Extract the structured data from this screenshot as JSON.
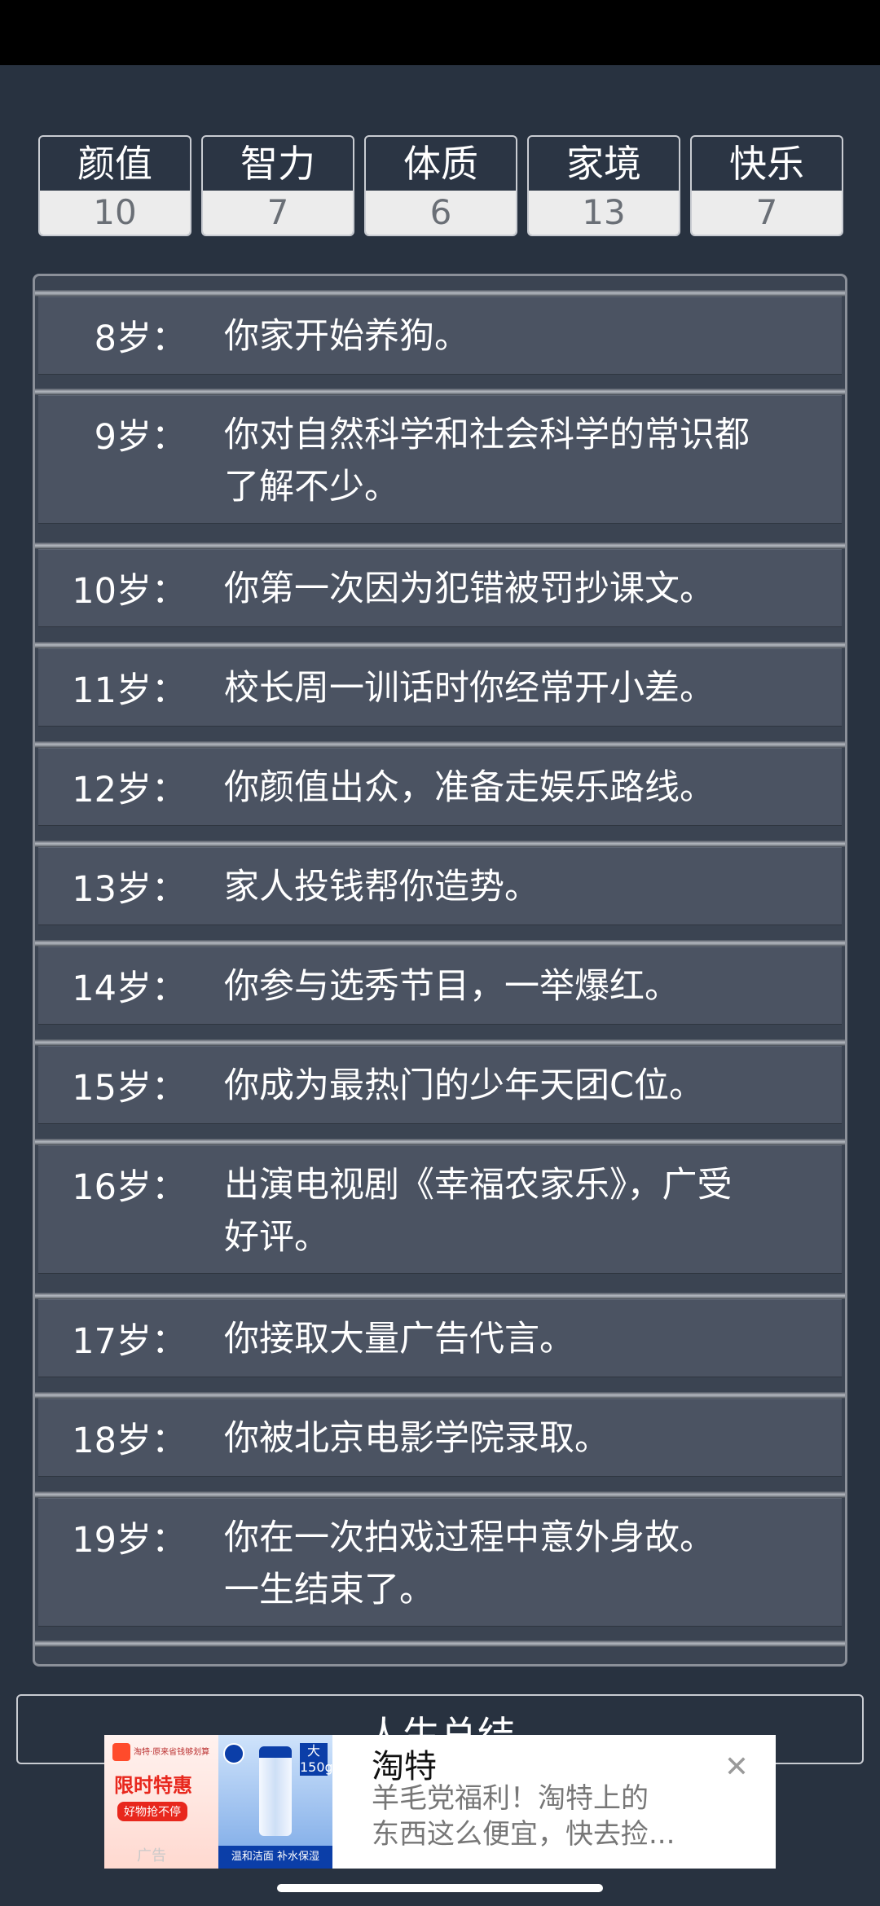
{
  "stats": [
    {
      "label": "颜值",
      "value": "10"
    },
    {
      "label": "智力",
      "value": "7"
    },
    {
      "label": "体质",
      "value": "6"
    },
    {
      "label": "家境",
      "value": "13"
    },
    {
      "label": "快乐",
      "value": "7"
    }
  ],
  "timeline": [
    {
      "age": "8岁：",
      "text": "你家开始养狗。"
    },
    {
      "age": "9岁：",
      "text": "你对自然科学和社会科学的常识都\n了解不少。"
    },
    {
      "age": "10岁：",
      "text": "你第一次因为犯错被罚抄课文。"
    },
    {
      "age": "11岁：",
      "text": "校长周一训话时你经常开小差。"
    },
    {
      "age": "12岁：",
      "text": "你颜值出众，准备走娱乐路线。"
    },
    {
      "age": "13岁：",
      "text": "家人投钱帮你造势。"
    },
    {
      "age": "14岁：",
      "text": "你参与选秀节目，一举爆红。"
    },
    {
      "age": "15岁：",
      "text": "你成为最热门的少年天团C位。"
    },
    {
      "age": "16岁：",
      "text": "出演电视剧《幸福农家乐》，广受\n好评。"
    },
    {
      "age": "17岁：",
      "text": "你接取大量广告代言。"
    },
    {
      "age": "18岁：",
      "text": "你被北京电影学院录取。"
    },
    {
      "age": "19岁：",
      "text": "你在一次拍戏过程中意外身故。\n一生结束了。"
    }
  ],
  "summary_button": "人生总结",
  "ad": {
    "title": "淘特",
    "description": "羊毛党福利！淘特上的\n东西这么便宜，快去捡...",
    "image1_small": "淘特·原来省钱够划算",
    "image1_big": "限时特惠",
    "image1_tag": "好物抢不停",
    "ad_mark": "广告",
    "image2_size": "大\n150g",
    "image2_caption": "温和洁面 补水保湿"
  }
}
